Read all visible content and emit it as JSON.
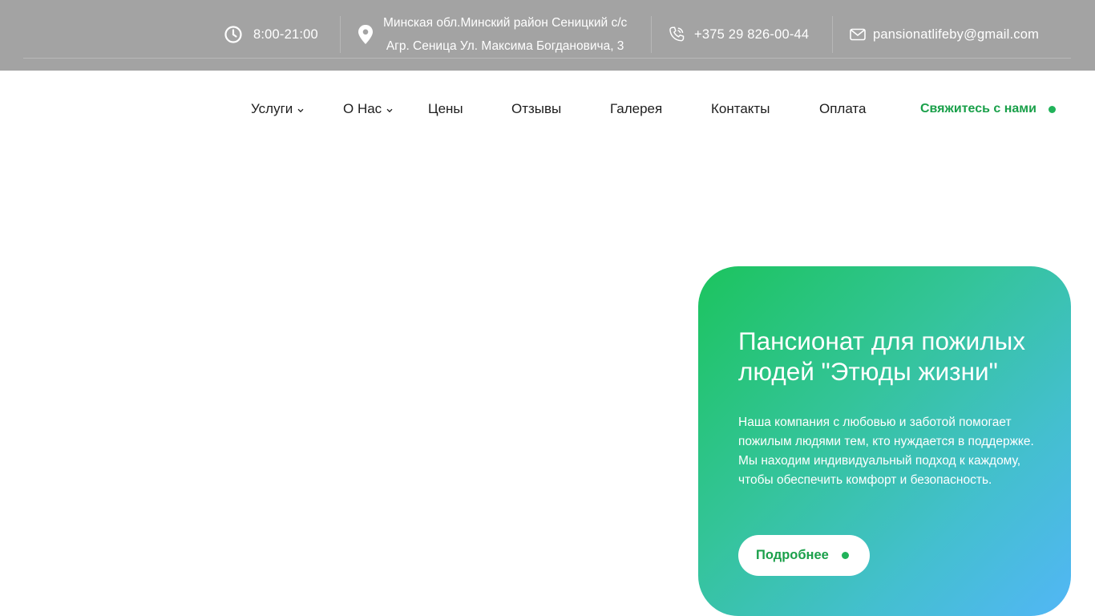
{
  "topbar": {
    "hours": "8:00-21:00",
    "address_line1": "Минская обл.Минский район Сеницкий с/с",
    "address_line2": "Агр. Сеница Ул. Максима Богдановича, 3",
    "phone": "+375 29 826-00-44",
    "email": "pansionatlifeby@gmail.com",
    "icons": [
      "clock-icon",
      "location-pin-icon",
      "phone-icon",
      "mail-icon"
    ]
  },
  "nav": {
    "items": [
      {
        "label": "Услуги",
        "has_dropdown": true
      },
      {
        "label": "О Нас",
        "has_dropdown": true
      },
      {
        "label": "Цены",
        "has_dropdown": false
      },
      {
        "label": "Отзывы",
        "has_dropdown": false
      },
      {
        "label": "Галерея",
        "has_dropdown": false
      },
      {
        "label": "Контакты",
        "has_dropdown": false
      },
      {
        "label": "Оплата",
        "has_dropdown": false
      }
    ],
    "cta_label": "Свяжитесь с нами"
  },
  "hero": {
    "title": "Пансионат для пожилых людей \"Этюды жизни\"",
    "text": "Наша компания с любовью и заботой помогает пожилым людями тем, кто нуждается в поддержке. Мы находим индивидуальный подход к каждому, чтобы обеспечить комфорт и безопасность.",
    "button_label": "Подробнее"
  },
  "colors": {
    "topbar_bg": "#a3a3a3",
    "accent_green": "#1aa04a",
    "gradient_start": "#1cc45e",
    "gradient_end": "#52b6f6"
  }
}
